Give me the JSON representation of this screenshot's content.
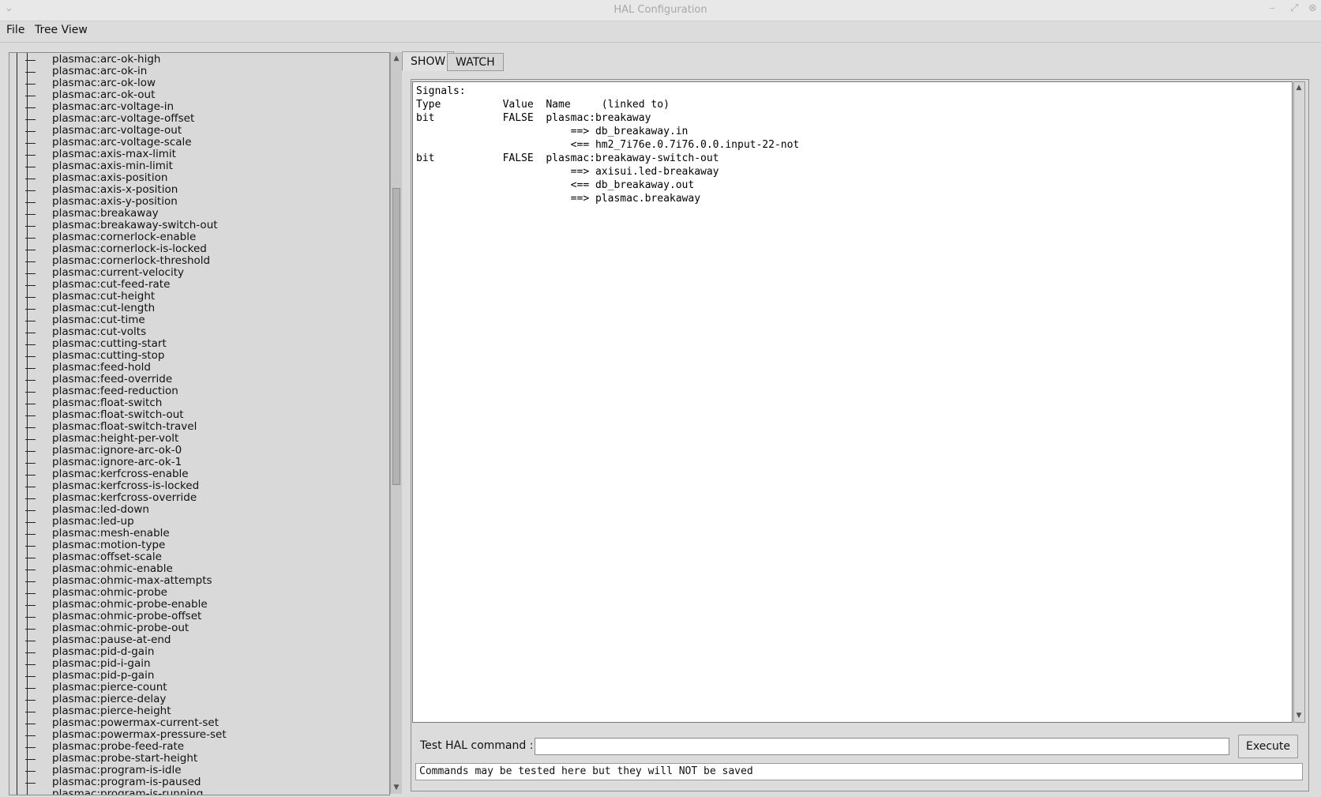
{
  "window": {
    "title": "HAL Configuration"
  },
  "menu": {
    "items": [
      "File",
      "Tree View"
    ]
  },
  "tree": {
    "items": [
      "plasmac:arc-ok-high",
      "plasmac:arc-ok-in",
      "plasmac:arc-ok-low",
      "plasmac:arc-ok-out",
      "plasmac:arc-voltage-in",
      "plasmac:arc-voltage-offset",
      "plasmac:arc-voltage-out",
      "plasmac:arc-voltage-scale",
      "plasmac:axis-max-limit",
      "plasmac:axis-min-limit",
      "plasmac:axis-position",
      "plasmac:axis-x-position",
      "plasmac:axis-y-position",
      "plasmac:breakaway",
      "plasmac:breakaway-switch-out",
      "plasmac:cornerlock-enable",
      "plasmac:cornerlock-is-locked",
      "plasmac:cornerlock-threshold",
      "plasmac:current-velocity",
      "plasmac:cut-feed-rate",
      "plasmac:cut-height",
      "plasmac:cut-length",
      "plasmac:cut-time",
      "plasmac:cut-volts",
      "plasmac:cutting-start",
      "plasmac:cutting-stop",
      "plasmac:feed-hold",
      "plasmac:feed-override",
      "plasmac:feed-reduction",
      "plasmac:float-switch",
      "plasmac:float-switch-out",
      "plasmac:float-switch-travel",
      "plasmac:height-per-volt",
      "plasmac:ignore-arc-ok-0",
      "plasmac:ignore-arc-ok-1",
      "plasmac:kerfcross-enable",
      "plasmac:kerfcross-is-locked",
      "plasmac:kerfcross-override",
      "plasmac:led-down",
      "plasmac:led-up",
      "plasmac:mesh-enable",
      "plasmac:motion-type",
      "plasmac:offset-scale",
      "plasmac:ohmic-enable",
      "plasmac:ohmic-max-attempts",
      "plasmac:ohmic-probe",
      "plasmac:ohmic-probe-enable",
      "plasmac:ohmic-probe-offset",
      "plasmac:ohmic-probe-out",
      "plasmac:pause-at-end",
      "plasmac:pid-d-gain",
      "plasmac:pid-i-gain",
      "plasmac:pid-p-gain",
      "plasmac:pierce-count",
      "plasmac:pierce-delay",
      "plasmac:pierce-height",
      "plasmac:powermax-current-set",
      "plasmac:powermax-pressure-set",
      "plasmac:probe-feed-rate",
      "plasmac:probe-start-height",
      "plasmac:program-is-idle",
      "plasmac:program-is-paused",
      "plasmac:program-is-running"
    ]
  },
  "tabs": [
    "SHOW",
    "WATCH"
  ],
  "show_output": {
    "lines": [
      "Signals:",
      "Type          Value  Name     (linked to)",
      "bit           FALSE  plasmac:breakaway",
      "                         ==> db_breakaway.in",
      "                         <== hm2_7i76e.0.7i76.0.0.input-22-not",
      "bit           FALSE  plasmac:breakaway-switch-out",
      "                         ==> axisui.led-breakaway",
      "                         <== db_breakaway.out",
      "                         ==> plasmac.breakaway"
    ]
  },
  "command": {
    "label": "Test HAL command :",
    "value": "",
    "execute_label": "Execute",
    "status": "Commands may be tested here but they will NOT be saved"
  }
}
